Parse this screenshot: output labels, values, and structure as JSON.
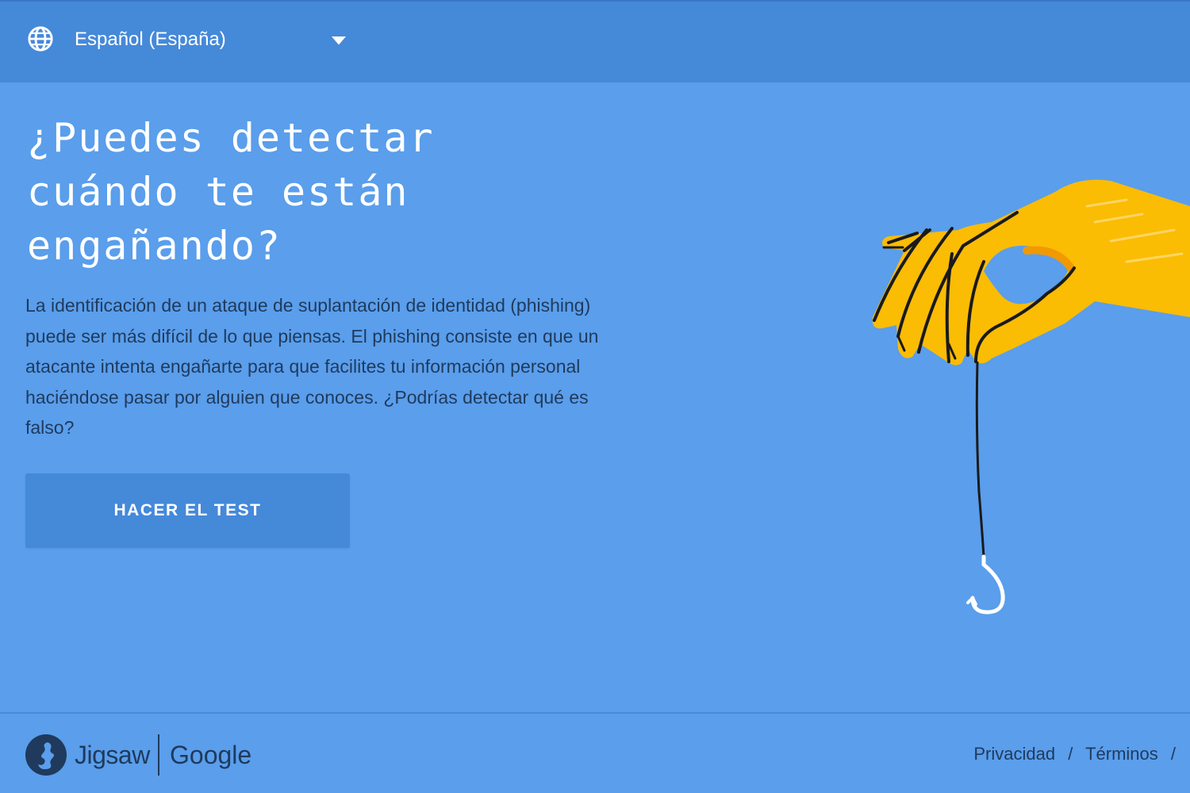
{
  "header": {
    "language": {
      "selected": "Español (España)",
      "icon": "globe-icon",
      "dropdown_icon": "chevron-down-icon"
    }
  },
  "hero": {
    "title_lines": [
      "¿Puedes detectar",
      "cuándo te están",
      "engañando?"
    ],
    "description": "La identificación de un ataque de suplantación de identidad (phishing) puede ser más difícil de lo que piensas. El phishing consiste en que un atacante intenta engañarte para que facilites tu información personal haciéndose pasar por alguien que conoces. ¿Podrías detectar qué es falso?",
    "cta_label": "HACER EL TEST",
    "illustration": "hand-holding-fishing-hook"
  },
  "footer": {
    "brand": {
      "jigsaw": "Jigsaw",
      "google": "Google",
      "logo_icon": "jigsaw-logo-icon"
    },
    "links": {
      "privacy": "Privacidad",
      "separator": "/",
      "terms": "Términos"
    }
  },
  "colors": {
    "background": "#5a9eec",
    "header_bar": "#4589d9",
    "button": "#4589d9",
    "text_dark": "#1f3a5c",
    "hand_yellow": "#fbbc04"
  }
}
